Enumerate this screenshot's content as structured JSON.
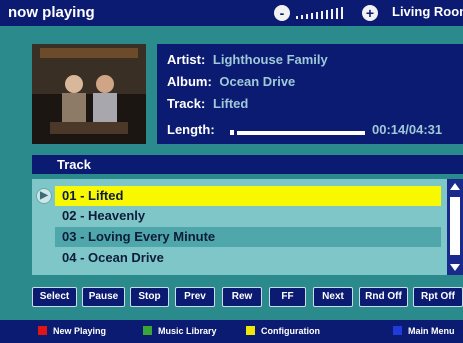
{
  "header": {
    "title": "now playing",
    "room": "Living Room",
    "volume": {
      "minus": "-",
      "plus": "+"
    }
  },
  "now_playing": {
    "artist_label": "Artist:",
    "artist": "Lighthouse Family",
    "album_label": "Album:",
    "album": "Ocean Drive",
    "track_label": "Track:",
    "track": "Lifted",
    "length_label": "Length:",
    "time": "00:14/04:31",
    "progress_fraction": 0.05
  },
  "track_section": {
    "label": "Track"
  },
  "tracks": [
    {
      "label": "01 - Lifted"
    },
    {
      "label": "02 - Heavenly"
    },
    {
      "label": "03 - Loving Every Minute"
    },
    {
      "label": "04 - Ocean Drive"
    }
  ],
  "controls": [
    {
      "label": "Select"
    },
    {
      "label": "Pause"
    },
    {
      "label": "Stop"
    },
    {
      "label": "Prev"
    },
    {
      "label": "Rew"
    },
    {
      "label": "FF"
    },
    {
      "label": "Next"
    },
    {
      "label": "Rnd Off"
    },
    {
      "label": "Rpt Off"
    }
  ],
  "legend": [
    {
      "label": "New Playing",
      "color": "#e01616"
    },
    {
      "label": "Music Library",
      "color": "#37a637"
    },
    {
      "label": "Configuration",
      "color": "#f0e60a"
    },
    {
      "label": "Main Menu",
      "color": "#1f3bd9"
    }
  ],
  "colors": {
    "background": "#2a8a8c",
    "panel": "#0c1b72",
    "selected": "#f8f800",
    "list": "#7ec6c8"
  }
}
